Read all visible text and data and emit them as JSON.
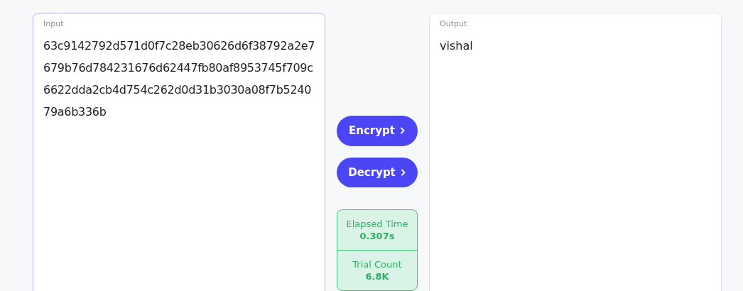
{
  "input": {
    "label": "Input",
    "value": "63c9142792d571d0f7c28eb30626d6f38792a2e7679b76d784231676d62447fb80af8953745f709c6622dda2cb4d754c262d0d31b3030a08f7b524079a6b336b"
  },
  "actions": [
    {
      "label": "Encrypt"
    },
    {
      "label": "Decrypt"
    }
  ],
  "stats": [
    {
      "label": "Elapsed Time",
      "value": "0.307s"
    },
    {
      "label": "Trial Count",
      "value": "6.8K"
    }
  ],
  "output": {
    "label": "Output",
    "value": "vishal"
  }
}
